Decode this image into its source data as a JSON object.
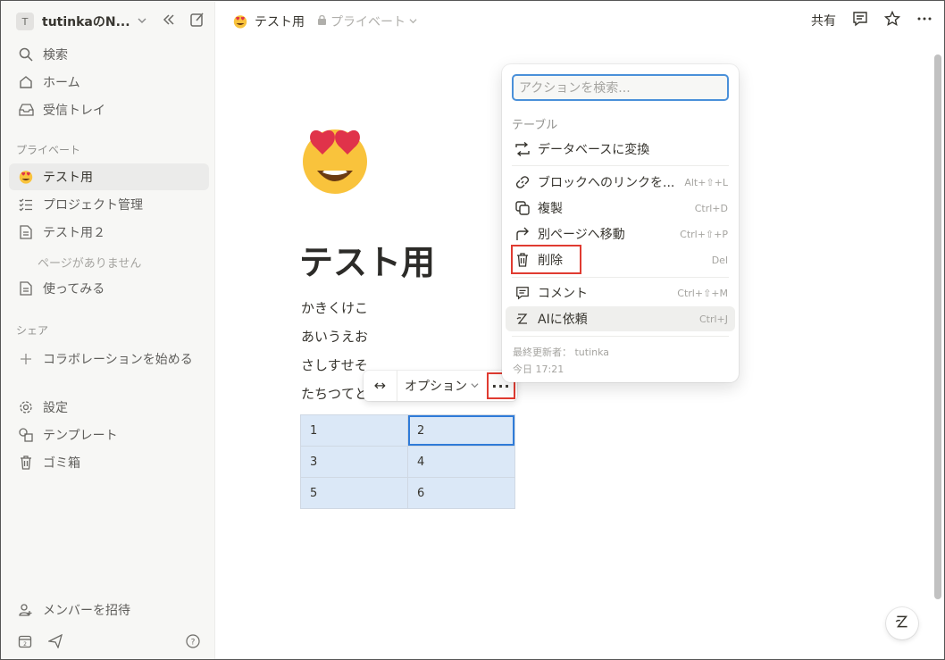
{
  "sidebar": {
    "workspace_initial": "T",
    "workspace_name": "tutinkaのN...",
    "nav": {
      "search": "検索",
      "home": "ホーム",
      "inbox": "受信トレイ"
    },
    "private_heading": "プライベート",
    "pages": {
      "test": "テスト用",
      "project": "プロジェクト管理",
      "test2": "テスト用２",
      "empty": "ページがありません",
      "try": "使ってみる"
    },
    "share_heading": "シェア",
    "start_collab": "コラボレーションを始める",
    "settings": "設定",
    "templates": "テンプレート",
    "trash": "ゴミ箱",
    "invite": "メンバーを招待"
  },
  "topbar": {
    "page_title": "テスト用",
    "visibility": "プライベート",
    "share": "共有"
  },
  "page": {
    "title": "テスト用",
    "paragraphs": [
      "かきくけこ",
      "あいうえお",
      "さしすせそ",
      "たちつてと"
    ]
  },
  "table_toolbar": {
    "options": "オプション",
    "more": "···"
  },
  "table": {
    "rows": [
      [
        "1",
        "2"
      ],
      [
        "3",
        "4"
      ],
      [
        "5",
        "6"
      ]
    ]
  },
  "menu": {
    "search_placeholder": "アクションを検索...",
    "section": "テーブル",
    "items": [
      {
        "label": "データベースに変換",
        "shortcut": ""
      },
      {
        "label": "ブロックへのリンクを...",
        "shortcut": "Alt+⇧+L"
      },
      {
        "label": "複製",
        "shortcut": "Ctrl+D"
      },
      {
        "label": "別ページへ移動",
        "shortcut": "Ctrl+⇧+P"
      },
      {
        "label": "削除",
        "shortcut": "Del"
      },
      {
        "label": "コメント",
        "shortcut": "Ctrl+⇧+M"
      },
      {
        "label": "AIに依頼",
        "shortcut": "Ctrl+J"
      }
    ],
    "last_edited": "最終更新者： tutinka",
    "edited_time": "今日 17:21"
  },
  "colors": {
    "highlight": "#e03b31",
    "selection": "#2f7bd8",
    "table_bg": "#dbe8f7"
  }
}
